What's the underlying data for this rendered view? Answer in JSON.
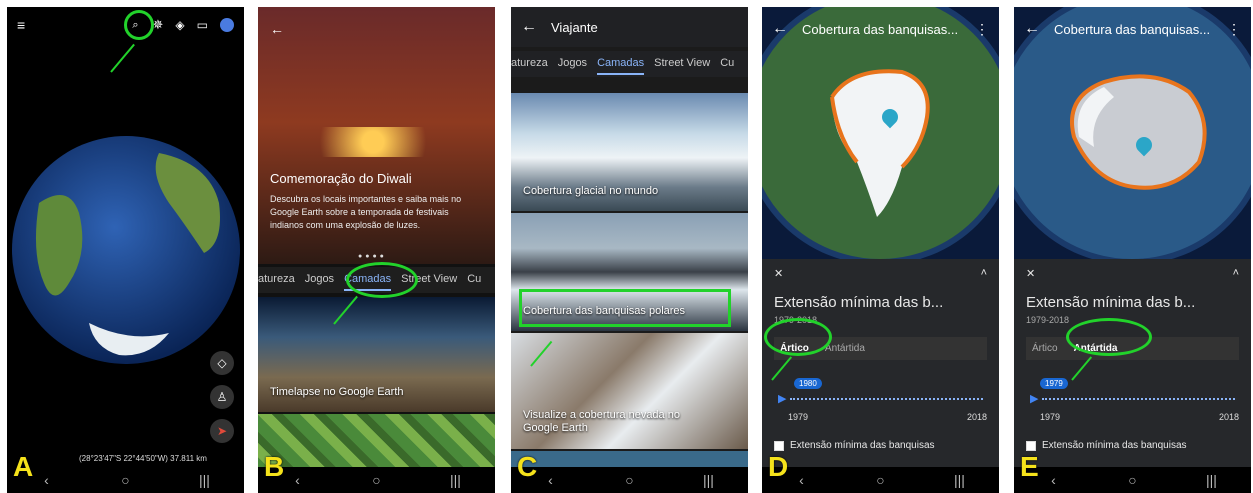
{
  "panels": {
    "a": {
      "letter": "A",
      "coords": "(28°23'47\"S 22°44'50\"W) 37.811 km",
      "icons": [
        "menu-icon",
        "search-icon",
        "voyager-icon",
        "dice-icon",
        "layers-icon",
        "account-icon",
        "compass-icon",
        "pegman-icon",
        "location-icon"
      ]
    },
    "b": {
      "letter": "B",
      "hero_title": "Comemoração do Diwali",
      "hero_desc": "Descubra os locais importantes e saiba mais no Google Earth sobre a temporada de festivais indianos com uma explosão de luzes.",
      "tabs": [
        "atureza",
        "Jogos",
        "Camadas",
        "Street View",
        "Cu"
      ],
      "active_tab": "Camadas",
      "card1": "Timelapse no Google Earth"
    },
    "c": {
      "letter": "C",
      "title": "Viajante",
      "tabs": [
        "atureza",
        "Jogos",
        "Camadas",
        "Street View",
        "Cu"
      ],
      "active_tab": "Camadas",
      "cards": [
        "Cobertura glacial no mundo",
        "Cobertura das banquisas polares",
        "Visualize a cobertura nevada no Google Earth"
      ]
    },
    "d": {
      "letter": "D",
      "title": "Cobertura das banquisas...",
      "sheet_title": "Extensão mínima das b...",
      "sheet_sub": "1979-2018",
      "seg": [
        "Ártico",
        "Antártida"
      ],
      "active_seg": "Ártico",
      "badge": "1980",
      "year_start": "1979",
      "year_end": "2018",
      "checkbox_label": "Extensão mínima das banquisas"
    },
    "e": {
      "letter": "E",
      "title": "Cobertura das banquisas...",
      "sheet_title": "Extensão mínima das b...",
      "sheet_sub": "1979-2018",
      "seg": [
        "Ártico",
        "Antártida"
      ],
      "active_seg": "Antártida",
      "badge": "1979",
      "year_start": "1979",
      "year_end": "2018",
      "checkbox_label": "Extensão mínima das banquisas"
    }
  },
  "nav": {
    "back": "‹",
    "home": "○",
    "recents": "|||"
  },
  "colors": {
    "highlight": "#22d22b",
    "letter": "#f5e21b",
    "accent": "#8ab4f8",
    "ice_outline": "#e8741c"
  }
}
